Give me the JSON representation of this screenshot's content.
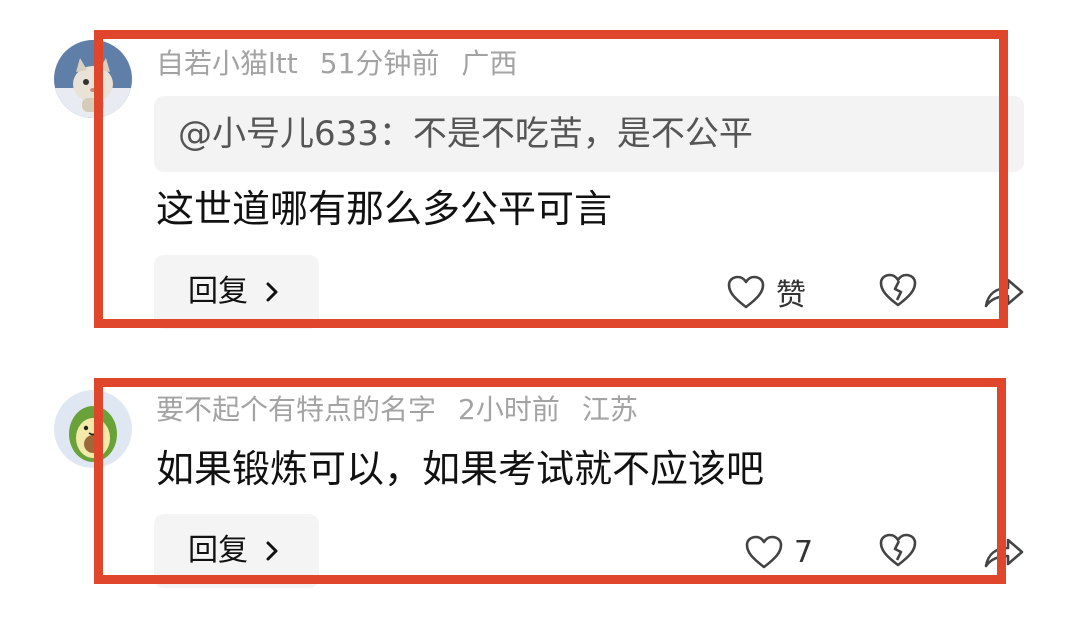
{
  "comments": [
    {
      "username": "自若小猫ltt",
      "time": "51分钟前",
      "location": "广西",
      "quote": "@小号儿633：不是不吃苦，是不公平",
      "text": "这世道哪有那么多公平可言",
      "reply_label": "回复",
      "like_label": "赞",
      "avatar_icon": "cat-avatar"
    },
    {
      "username": "要不起个有特点的名字",
      "time": "2小时前",
      "location": "江苏",
      "text": "如果锻炼可以，如果考试就不应该吧",
      "reply_label": "回复",
      "like_label": "7",
      "avatar_icon": "avocado-avatar"
    }
  ],
  "colors": {
    "highlight": "#e0462c",
    "meta_text": "#a3a3a3",
    "bubble_bg": "#f3f3f3"
  },
  "icons": {
    "like": "heart-outline-icon",
    "dislike": "broken-heart-icon",
    "share": "share-arrow-icon",
    "reply_chevron": "chevron-right-icon"
  }
}
